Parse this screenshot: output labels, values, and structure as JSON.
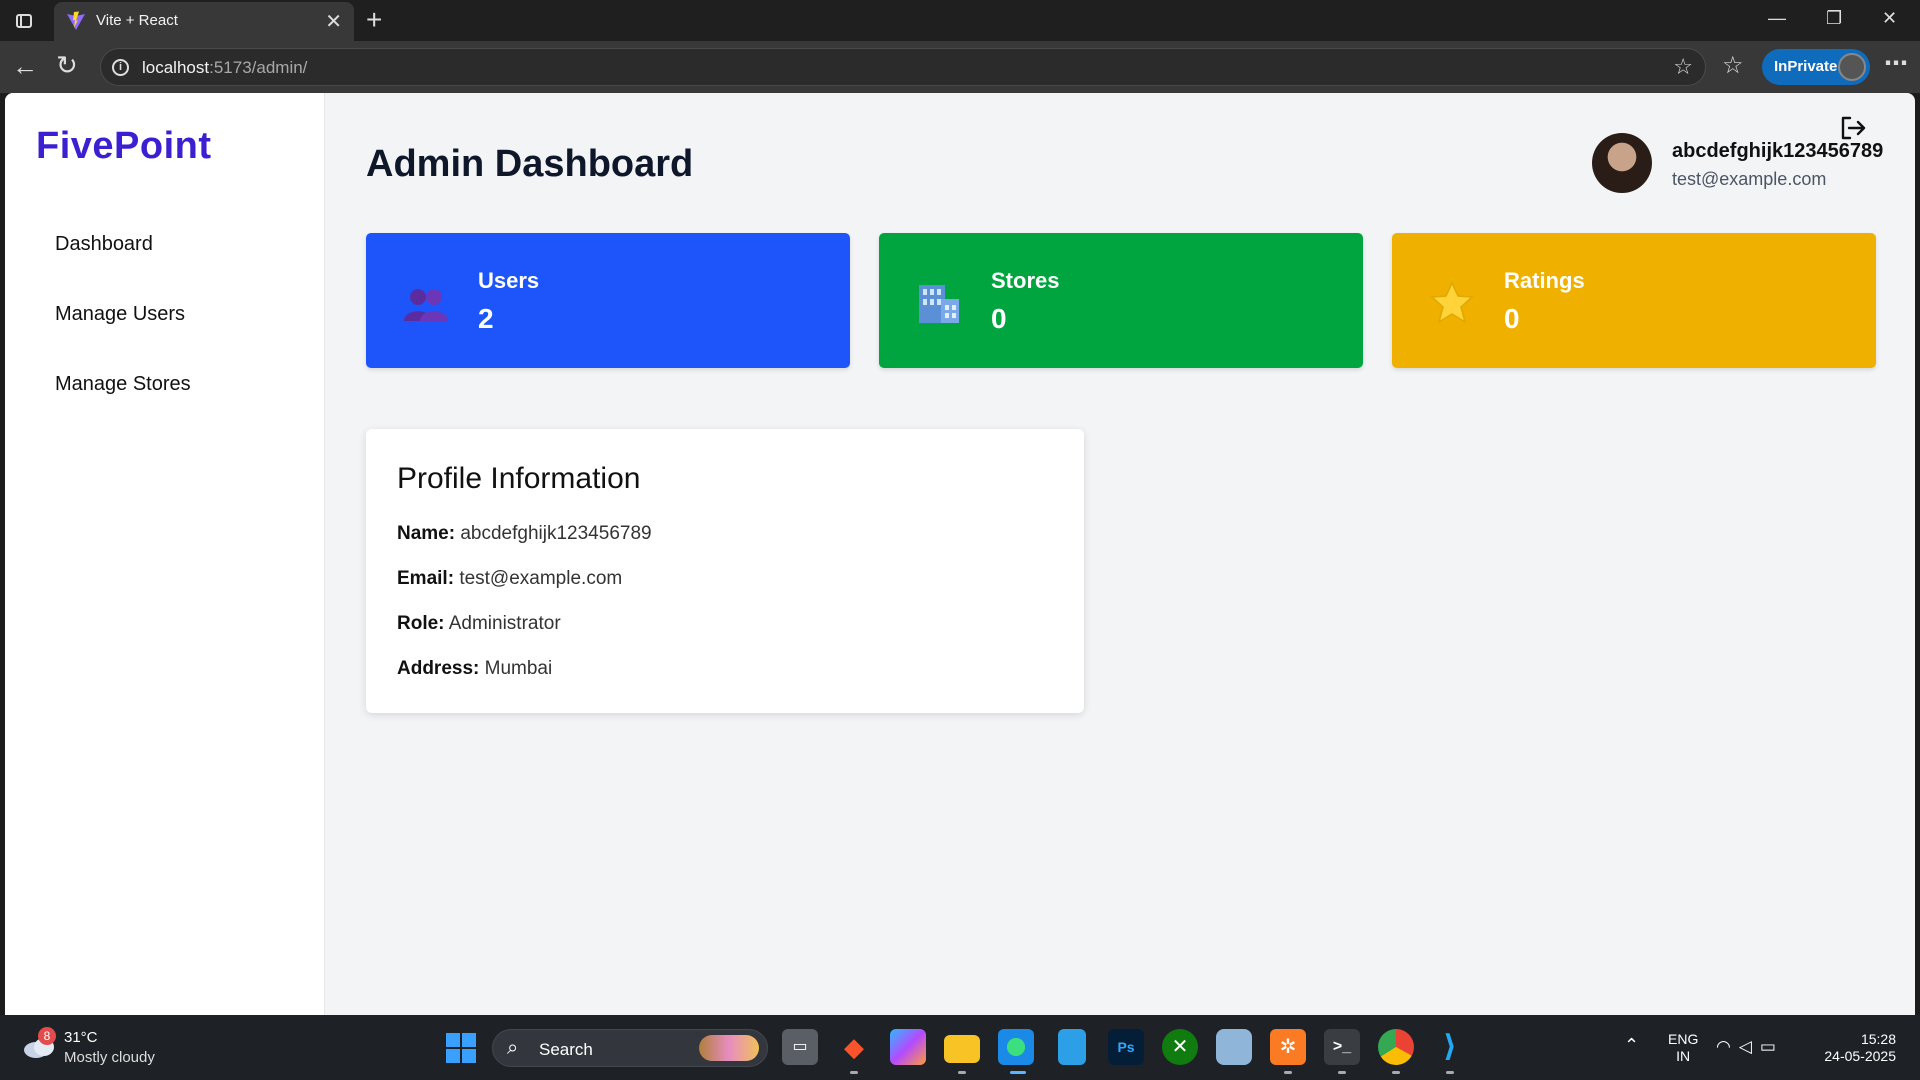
{
  "browser": {
    "tab_title": "Vite + React",
    "url_host": "localhost",
    "url_rest": ":5173/admin/",
    "inprivate_label": "InPrivate"
  },
  "sidebar": {
    "brand": "FivePoint",
    "items": [
      {
        "label": "Dashboard"
      },
      {
        "label": "Manage Users"
      },
      {
        "label": "Manage Stores"
      }
    ]
  },
  "header": {
    "title": "Admin Dashboard",
    "user_name": "abcdefghijk123456789",
    "user_email": "test@example.com"
  },
  "stats": [
    {
      "label": "Users",
      "value": "2",
      "color": "#1d55fb",
      "icon": "users-icon"
    },
    {
      "label": "Stores",
      "value": "0",
      "color": "#00a53f",
      "icon": "building-icon"
    },
    {
      "label": "Ratings",
      "value": "0",
      "color": "#efb000",
      "icon": "star-icon"
    }
  ],
  "profile": {
    "title": "Profile Information",
    "name_label": "Name:",
    "name": "abcdefghijk123456789",
    "email_label": "Email:",
    "email": "test@example.com",
    "role_label": "Role:",
    "role": "Administrator",
    "address_label": "Address:",
    "address": "Mumbai"
  },
  "taskbar": {
    "weather_badge": "8",
    "weather_temp": "31°C",
    "weather_desc": "Mostly cloudy",
    "search_label": "Search",
    "lang_top": "ENG",
    "lang_bottom": "IN",
    "time": "15:28",
    "date": "24-05-2025"
  }
}
